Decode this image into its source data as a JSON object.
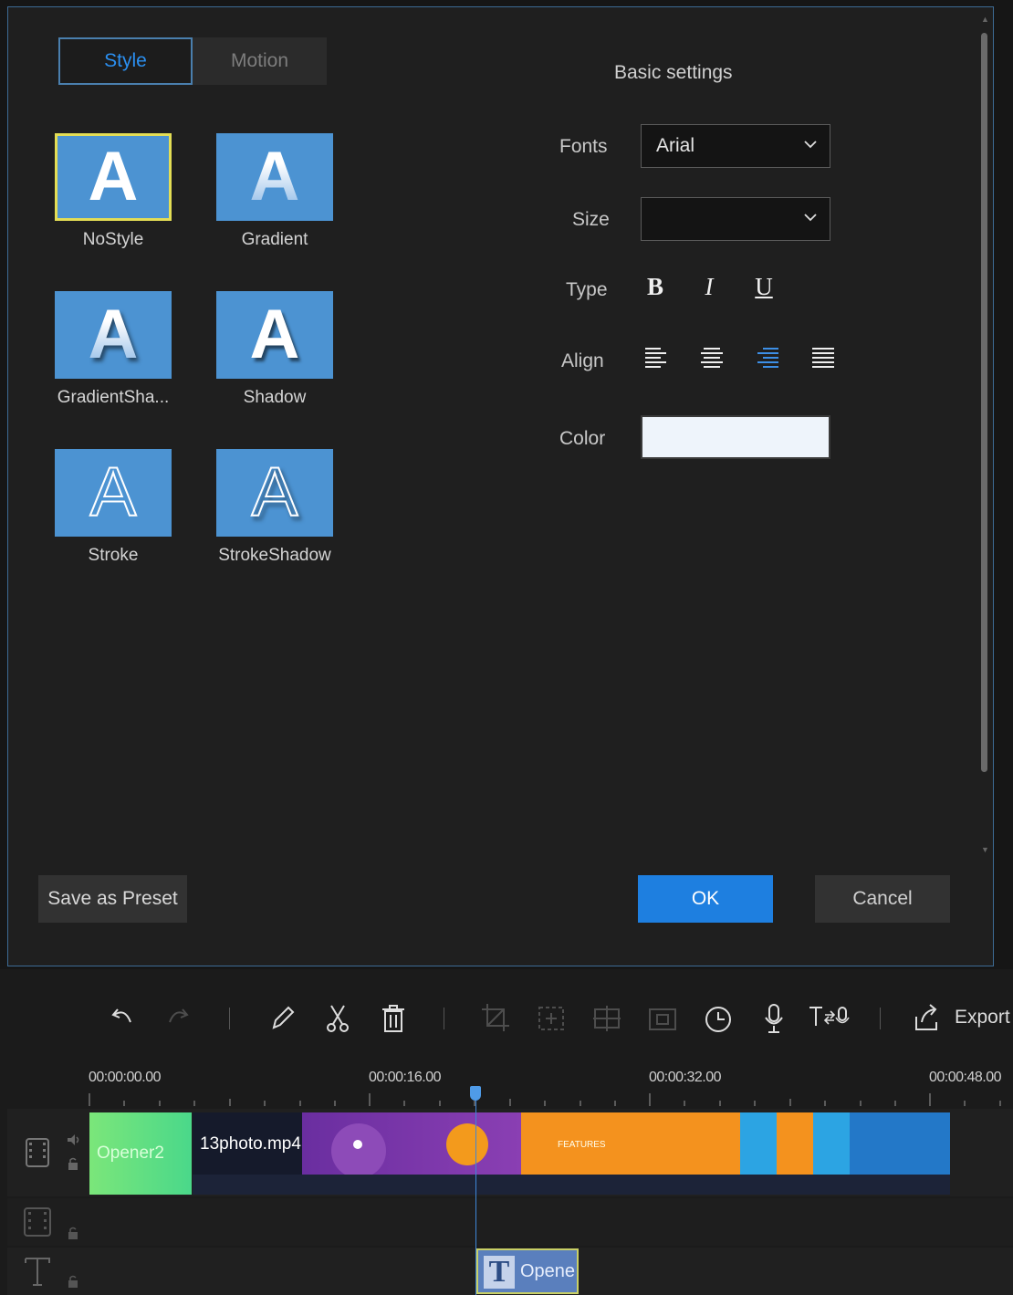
{
  "dialog": {
    "tabs": [
      {
        "label": "Style",
        "active": true
      },
      {
        "label": "Motion",
        "active": false
      }
    ],
    "styles": [
      {
        "glyph": "A",
        "label": "NoStyle",
        "selected": true
      },
      {
        "glyph": "A",
        "label": "Gradient",
        "selected": false
      },
      {
        "glyph": "A",
        "label": "GradientSha...",
        "selected": false
      },
      {
        "glyph": "A",
        "label": "Shadow",
        "selected": false
      },
      {
        "glyph": "A",
        "label": "Stroke",
        "selected": false
      },
      {
        "glyph": "A",
        "label": "StrokeShadow",
        "selected": false
      }
    ],
    "settings": {
      "title": "Basic settings",
      "fonts_label": "Fonts",
      "fonts_value": "Arial",
      "size_label": "Size",
      "size_value": "",
      "type_label": "Type",
      "type_buttons": [
        "B",
        "I",
        "U"
      ],
      "align_label": "Align",
      "align_active": "right",
      "color_label": "Color",
      "color_value": "#eef4fb"
    },
    "buttons": {
      "save_preset": "Save as Preset",
      "ok": "OK",
      "cancel": "Cancel"
    }
  },
  "toolbar": {
    "export_label": "Export"
  },
  "timeline": {
    "ruler_times": [
      "00:00:00.00",
      "00:00:16.00",
      "00:00:32.00",
      "00:00:48.00"
    ],
    "clips": [
      {
        "label": "Opener2"
      },
      {
        "label": "13photo.mp4"
      }
    ],
    "text_clip_label": "Opene"
  },
  "colors": {
    "accent": "#1e7fe0",
    "selection": "#e3dd55",
    "thumb_bg": "#4c93d2"
  }
}
